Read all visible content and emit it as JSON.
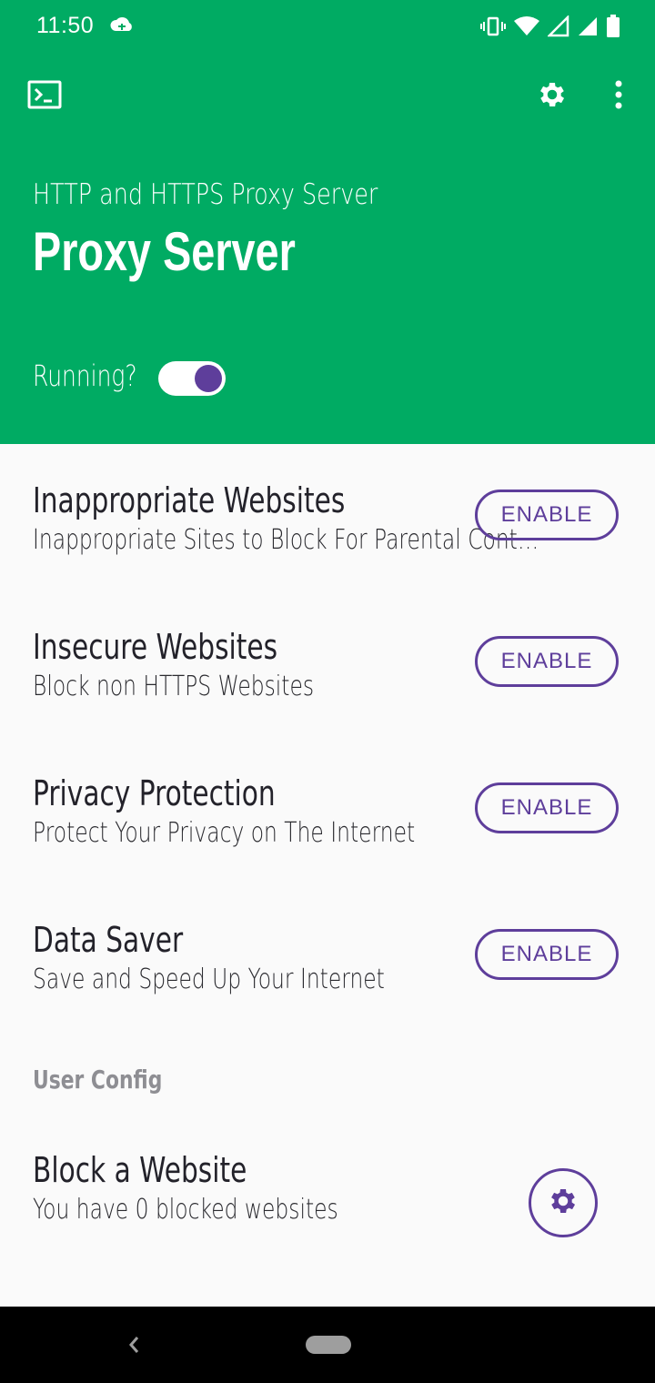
{
  "status_bar": {
    "time": "11:50"
  },
  "header": {
    "subtitle": "HTTP and HTTPS Proxy Server",
    "title": "Proxy Server",
    "running_label": "Running?",
    "running": true,
    "background_color": "#00ab63",
    "accent_color": "#5e3e9b"
  },
  "toolbar": {
    "icons": [
      "terminal-icon",
      "gear-icon",
      "more-vert-icon"
    ]
  },
  "features": [
    {
      "title": "Inappropriate Websites",
      "subtitle": "Inappropriate Sites to Block For Parental Cont…",
      "button": "ENABLE"
    },
    {
      "title": "Insecure Websites",
      "subtitle": "Block non HTTPS Websites",
      "button": "ENABLE"
    },
    {
      "title": "Privacy Protection",
      "subtitle": "Protect Your Privacy on The Internet",
      "button": "ENABLE"
    },
    {
      "title": "Data Saver",
      "subtitle": "Save and Speed Up Your Internet",
      "button": "ENABLE"
    }
  ],
  "user_config": {
    "section_label": "User Config",
    "block": {
      "title": "Block a Website",
      "subtitle": "You have 0 blocked websites"
    }
  }
}
